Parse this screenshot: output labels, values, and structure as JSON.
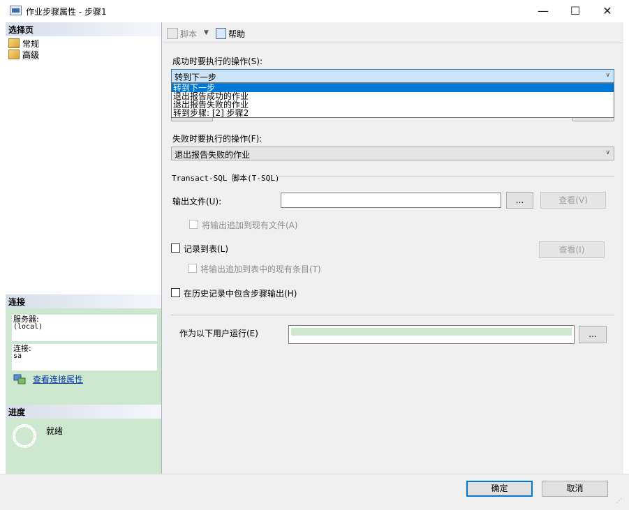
{
  "window": {
    "title": "作业步骤属性 - 步骤1",
    "minimize_glyph": "—",
    "maximize_glyph": "☐",
    "close_glyph": "✕"
  },
  "sidebar": {
    "select_page_header": "选择页",
    "pages": [
      {
        "label": "常规",
        "icon": "page-icon"
      },
      {
        "label": "高级",
        "icon": "page-icon"
      }
    ],
    "connection_header": "连接",
    "server_label": "服务器:",
    "server_value": "(local)",
    "connection_label": "连接:",
    "connection_value": "sa",
    "view_connection_link": "查看连接属性",
    "progress_header": "进度",
    "progress_status": "就绪"
  },
  "toolbar": {
    "script_label": "脚本",
    "help_label": "帮助"
  },
  "form": {
    "on_success_label": "成功时要执行的操作(S):",
    "on_success_value": "转到下一步",
    "on_success_options": [
      "转到下一步",
      "退出报告成功的作业",
      "退出报告失败的作业",
      "转到步骤: [2] 步骤2"
    ],
    "on_failure_label": "失败时要执行的操作(F):",
    "on_failure_value": "退出报告失败的作业",
    "tsql_group_label": "Transact-SQL 脚本(T-SQL)",
    "output_file_label": "输出文件(U):",
    "browse_label": "...",
    "view_output_label": "查看(V)",
    "append_output_label": "将输出追加到现有文件(A)",
    "log_to_table_label": "记录到表(L)",
    "view_table_label": "查看(I)",
    "append_table_label": "将输出追加到表中的现有条目(T)",
    "include_history_label": "在历史记录中包含步骤输出(H)",
    "run_as_label": "作为以下用户运行(E)",
    "run_as_browse_label": "..."
  },
  "footer": {
    "ok_label": "确定",
    "cancel_label": "取消"
  },
  "colors": {
    "accent": "#0078d7",
    "green_panel": "#cde8cf",
    "link": "#0a37a8"
  }
}
